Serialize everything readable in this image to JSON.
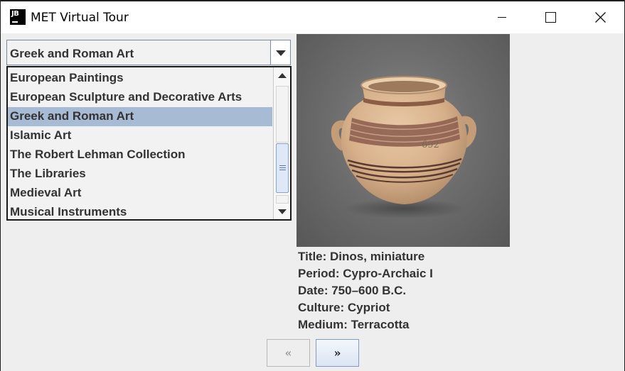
{
  "window": {
    "app_icon": "JB",
    "title": "MET Virtual Tour",
    "controls": [
      "minimize-icon",
      "maximize-icon",
      "close-icon"
    ]
  },
  "department_combo": {
    "selected": "Greek and Roman Art"
  },
  "department_list": {
    "items": [
      {
        "label": "European Paintings",
        "selected": false
      },
      {
        "label": "European Sculpture and Decorative Arts",
        "selected": false
      },
      {
        "label": "Greek and Roman Art",
        "selected": true
      },
      {
        "label": "Islamic Art",
        "selected": false
      },
      {
        "label": "The Robert Lehman Collection",
        "selected": false
      },
      {
        "label": "The Libraries",
        "selected": false
      },
      {
        "label": "Medieval Art",
        "selected": false
      },
      {
        "label": "Musical Instruments",
        "selected": false
      }
    ]
  },
  "artwork": {
    "image_subject": "miniature terracotta dinos vase",
    "inventory_mark": "692",
    "title": "Title: Dinos, miniature",
    "period": "Period: Cypro-Archaic I",
    "date": "Date: 750–600 B.C.",
    "culture": "Culture: Cypriot",
    "medium": "Medium: Terracotta"
  },
  "navigation": {
    "prev_label": "«",
    "next_label": "»",
    "prev_enabled": false,
    "next_enabled": true
  },
  "colors": {
    "selection": "#a8bbd5",
    "text": "#333333",
    "window_bg": "#eeeeee"
  }
}
